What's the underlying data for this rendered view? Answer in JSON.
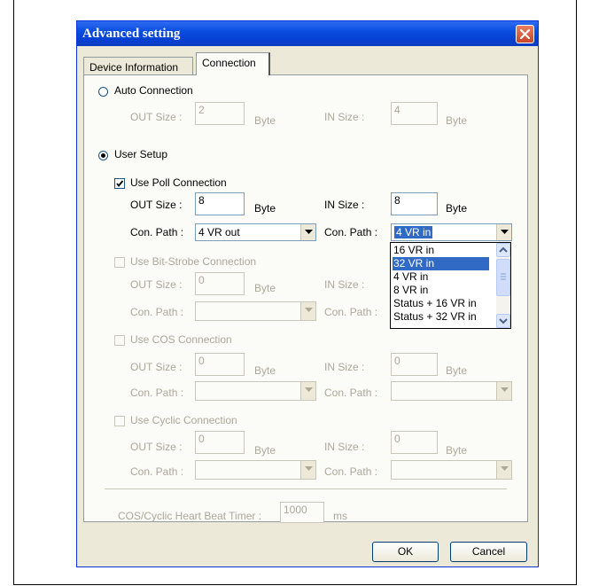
{
  "dialog": {
    "title": "Advanced setting"
  },
  "tabs": [
    {
      "label": "Device Information"
    },
    {
      "label": "Connection"
    }
  ],
  "auto": {
    "label": "Auto Connection",
    "out_label": "OUT Size :",
    "out_value": "2",
    "out_unit": "Byte",
    "in_label": "IN Size :",
    "in_value": "4",
    "in_unit": "Byte"
  },
  "user_setup": {
    "label": "User Setup"
  },
  "poll": {
    "label": "Use Poll Connection",
    "out_label": "OUT Size :",
    "out_value": "8",
    "out_unit": "Byte",
    "in_label": "IN Size :",
    "in_value": "8",
    "in_unit": "Byte",
    "out_path_label": "Con. Path :",
    "out_path_value": "4 VR out",
    "in_path_label": "Con. Path :",
    "in_path_value": "4 VR in"
  },
  "dropdown_options": [
    "16 VR in",
    "32 VR in",
    "4 VR in",
    "8 VR in",
    "Status + 16 VR in",
    "Status + 32 VR in"
  ],
  "bitstrobe": {
    "label": "Use Bit-Strobe Connection",
    "out_label": "OUT Size :",
    "out_value": "0",
    "out_unit": "Byte",
    "in_label": "IN Size :",
    "out_path_label": "Con. Path :",
    "in_path_label": "Con. Path :"
  },
  "cos": {
    "label": "Use COS Connection",
    "out_label": "OUT Size :",
    "out_value": "0",
    "out_unit": "Byte",
    "in_label": "IN Size :",
    "in_value": "0",
    "in_unit": "Byte",
    "out_path_label": "Con. Path :",
    "in_path_label": "Con. Path :"
  },
  "cyclic": {
    "label": "Use Cyclic Connection",
    "out_label": "OUT Size :",
    "out_value": "0",
    "out_unit": "Byte",
    "in_label": "IN Size :",
    "in_value": "0",
    "in_unit": "Byte",
    "out_path_label": "Con. Path :",
    "in_path_label": "Con. Path :"
  },
  "heartbeat": {
    "label": "COS/Cyclic Heart Beat Timer :",
    "value": "1000",
    "unit": "ms"
  },
  "buttons": {
    "ok": "OK",
    "cancel": "Cancel"
  },
  "colors": {
    "titlebar": "#0a4ee0",
    "selection": "#316ac5",
    "dialog_bg": "#ece9d8",
    "close_button": "#d9613b"
  },
  "icons": [
    "close-icon",
    "checkmark-icon",
    "dropdown-arrow-icon",
    "scroll-up-icon",
    "scroll-down-icon"
  ]
}
